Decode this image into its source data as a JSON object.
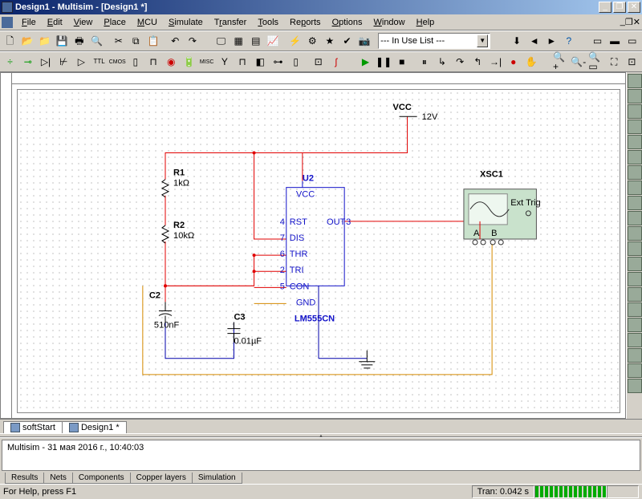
{
  "title": "Design1 - Multisim - [Design1 *]",
  "menu": [
    "File",
    "Edit",
    "View",
    "Place",
    "MCU",
    "Simulate",
    "Transfer",
    "Tools",
    "Reports",
    "Options",
    "Window",
    "Help"
  ],
  "inuse_combo": "--- In Use List ---",
  "sheet_tabs": [
    "softStart",
    "Design1 *"
  ],
  "output_text": "Multisim  -  31 мая 2016 г., 10:40:03",
  "output_tabs": [
    "Results",
    "Nets",
    "Components",
    "Copper layers",
    "Simulation"
  ],
  "status_left": "For Help, press F1",
  "status_tran": "Tran: 0.042 s",
  "circuit": {
    "vcc_label": "VCC",
    "vcc_value": "12V",
    "r1": {
      "ref": "R1",
      "value": "1kΩ"
    },
    "r2": {
      "ref": "R2",
      "value": "10kΩ"
    },
    "c2": {
      "ref": "C2",
      "value": "510nF"
    },
    "c3": {
      "ref": "C3",
      "value": "0.01µF"
    },
    "u2": {
      "ref": "U2",
      "part": "LM555CN",
      "pins": {
        "vcc": "VCC",
        "rst": "RST",
        "dis": "DIS",
        "thr": "THR",
        "tri": "TRI",
        "con": "CON",
        "gnd": "GND",
        "out": "OUT"
      },
      "pin_nums": {
        "rst": "4",
        "dis": "7",
        "thr": "6",
        "tri": "2",
        "con": "5",
        "out": "3"
      }
    },
    "scope": {
      "ref": "XSC1",
      "ext": "Ext Trig",
      "a": "A",
      "b": "B"
    }
  }
}
